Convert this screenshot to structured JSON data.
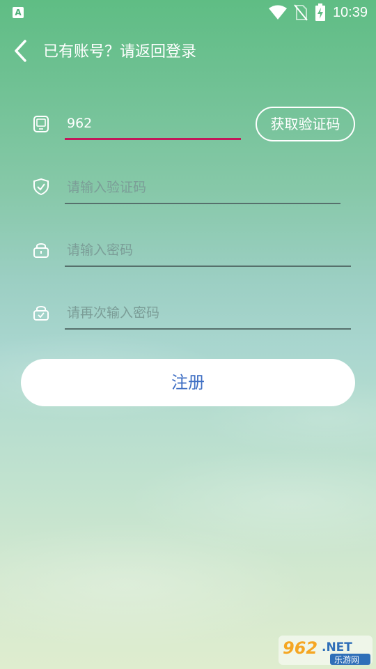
{
  "status_bar": {
    "app_icon_letter": "A",
    "time": "10:39"
  },
  "header": {
    "title": "已有账号？请返回登录"
  },
  "form": {
    "phone": {
      "value": "962",
      "placeholder": ""
    },
    "get_code_label": "获取验证码",
    "code": {
      "value": "",
      "placeholder": "请输入验证码"
    },
    "password": {
      "value": "",
      "placeholder": "请输入密码"
    },
    "confirm_password": {
      "value": "",
      "placeholder": "请再次输入密码"
    },
    "register_label": "注册"
  },
  "watermark": {
    "logo_text": "962.NET",
    "logo_subtext": "乐游网"
  },
  "colors": {
    "accent_underline": "#c2185b",
    "register_text": "#3f6fc4"
  }
}
